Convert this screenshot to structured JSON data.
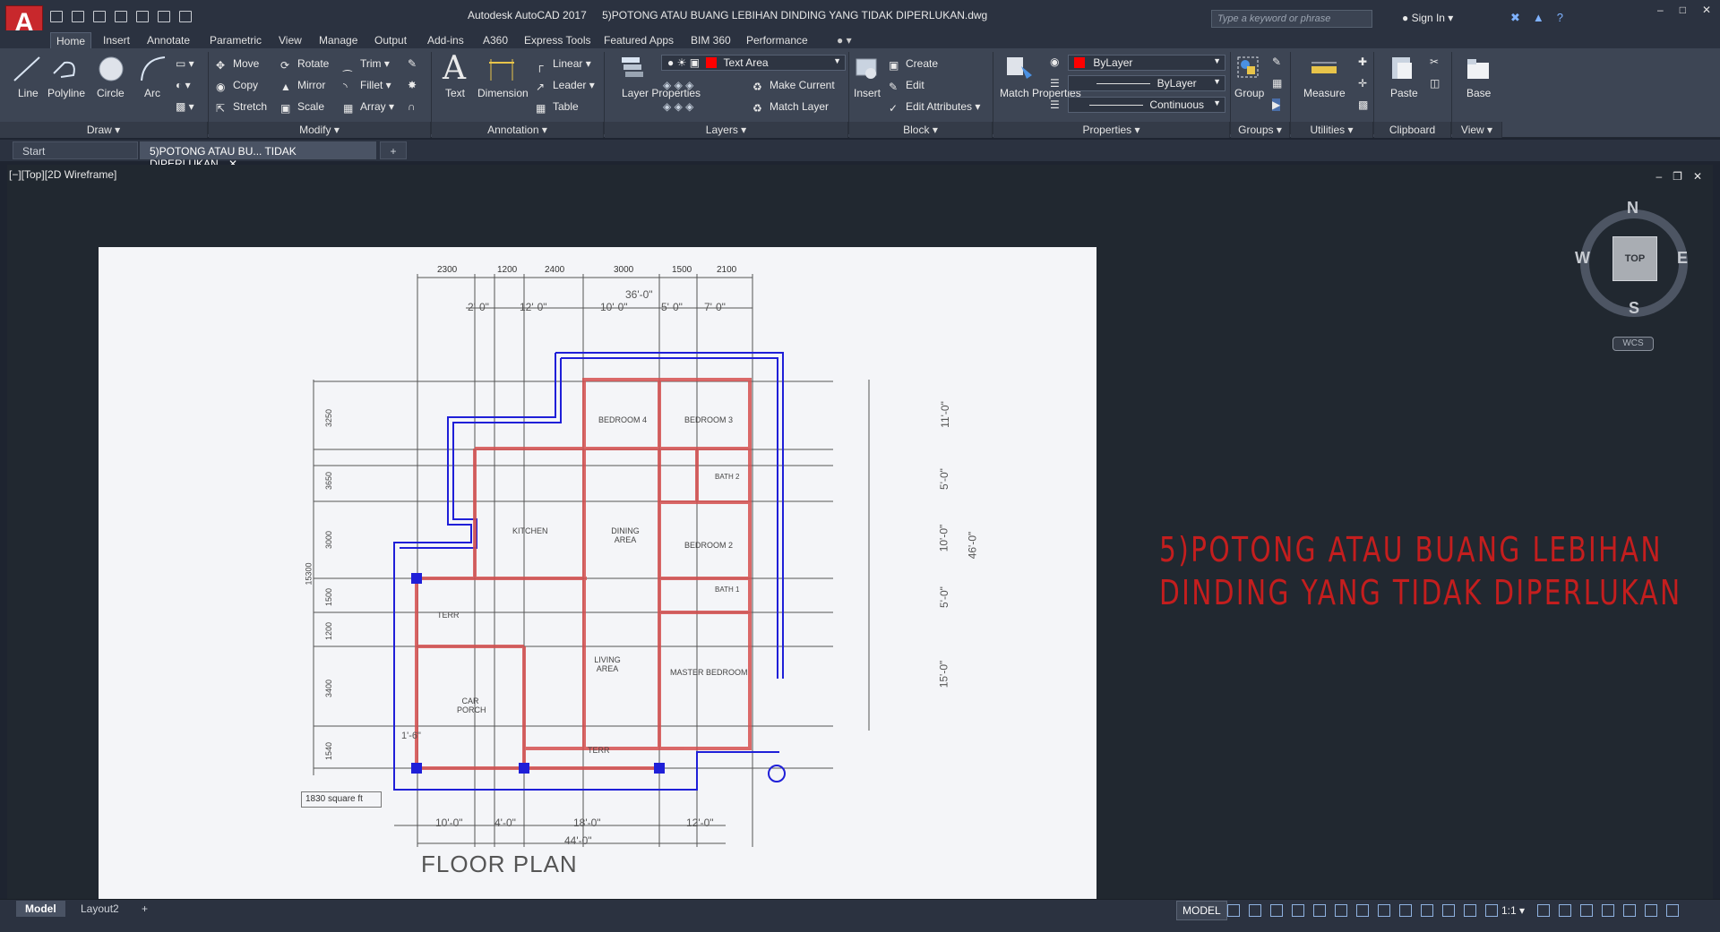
{
  "window": {
    "app_title": "Autodesk AutoCAD 2017",
    "file_title": "5)POTONG ATAU BUANG LEBIHAN DINDING YANG TIDAK DIPERLUKAN.dwg",
    "search_placeholder": "Type a keyword or phrase",
    "sign_in": "Sign In"
  },
  "ribbon": {
    "tabs": [
      "Home",
      "Insert",
      "Annotate",
      "Parametric",
      "View",
      "Manage",
      "Output",
      "Add-ins",
      "A360",
      "Express Tools",
      "Featured Apps",
      "BIM 360",
      "Performance"
    ],
    "active_tab": "Home",
    "draw": {
      "line": "Line",
      "polyline": "Polyline",
      "circle": "Circle",
      "arc": "Arc",
      "footer": "Draw"
    },
    "modify": {
      "move": "Move",
      "rotate": "Rotate",
      "trim": "Trim",
      "copy": "Copy",
      "mirror": "Mirror",
      "fillet": "Fillet",
      "stretch": "Stretch",
      "scale": "Scale",
      "array": "Array",
      "footer": "Modify"
    },
    "annotation": {
      "text": "Text",
      "dimension": "Dimension",
      "linear": "Linear",
      "leader": "Leader",
      "table": "Table",
      "footer": "Annotation"
    },
    "layers": {
      "layer_properties": "Layer Properties",
      "current_layer": "Text Area",
      "make_current": "Make Current",
      "match_layer": "Match Layer",
      "footer": "Layers",
      "layer_color": "#ff0000"
    },
    "block": {
      "insert": "Insert",
      "create": "Create",
      "edit": "Edit",
      "edit_attributes": "Edit Attributes",
      "footer": "Block"
    },
    "properties": {
      "match_properties": "Match Properties",
      "color": "ByLayer",
      "lineweight": "ByLayer",
      "linetype": "Continuous",
      "footer": "Properties"
    },
    "groups": {
      "group": "Group",
      "footer": "Groups"
    },
    "utilities": {
      "measure": "Measure",
      "footer": "Utilities"
    },
    "clipboard": {
      "paste": "Paste",
      "footer": "Clipboard"
    },
    "view": {
      "base": "Base",
      "footer": "View"
    }
  },
  "file_tabs": {
    "start": "Start",
    "current": "5)POTONG ATAU BU... TIDAK DIPERLUKAN"
  },
  "viewport": {
    "label": "[−][Top][2D Wireframe]"
  },
  "drawing": {
    "top_dims_mm": [
      "2300",
      "1200",
      "2400",
      "3000",
      "1500",
      "2100"
    ],
    "top_dims_ft": [
      "2'-0\"",
      "12'-0\"",
      "10'-0\"",
      "5'-0\"",
      "7'-0\""
    ],
    "overall_top": "36'-0\"",
    "left_dims_mm": [
      "3250",
      "3650",
      "3000",
      "1500",
      "1200",
      "3400",
      "1540"
    ],
    "left_overall": "15300",
    "right_dims_ft": [
      "11'-0\"",
      "5'-0\"",
      "10'-0\"",
      "5'-0\"",
      "15'-0\""
    ],
    "right_overall": "46'-0\"",
    "bottom_dims_ft": [
      "10'-0\"",
      "4'-0\"",
      "18'-0\"",
      "12'-0\""
    ],
    "bottom_overall": "44'-0\"",
    "rooms": [
      "BEDROOM 4",
      "BEDROOM 3",
      "BATH 2",
      "KITCHEN",
      "DINING AREA",
      "BEDROOM 2",
      "BATH 1",
      "TERR",
      "LIVING AREA",
      "MASTER BEDROOM",
      "CAR PORCH",
      "TERR"
    ],
    "area_note": "1830 square ft",
    "title": "FLOOR PLAN",
    "small_dim": "1'-6\""
  },
  "annotation_text": {
    "line1": "5)POTONG ATAU BUANG LEBIHAN",
    "line2": "DINDING YANG TIDAK DIPERLUKAN",
    "color": "#c41e1e"
  },
  "viewcube": {
    "n": "N",
    "s": "S",
    "e": "E",
    "w": "W",
    "top": "TOP",
    "wcs": "WCS"
  },
  "status": {
    "model_tab": "Model",
    "layout_tab": "Layout2",
    "model_button": "MODEL",
    "scale": "1:1"
  }
}
